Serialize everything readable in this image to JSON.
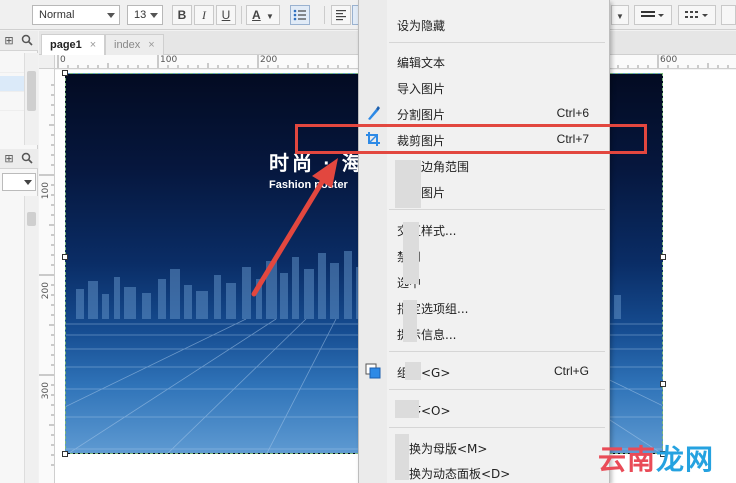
{
  "toolbar": {
    "style_value": "Normal",
    "font_size_value": "13",
    "bold_label": "B",
    "italic_label": "I",
    "underline_label": "U",
    "font_color_label": "A"
  },
  "tabs": [
    {
      "label": "page1",
      "close": "×"
    },
    {
      "label": "index",
      "close": "×"
    }
  ],
  "ruler": {
    "h_labels": [
      "0",
      "100",
      "200",
      "600"
    ],
    "v_labels": [
      "100",
      "200",
      "300"
    ]
  },
  "poster": {
    "title": "时尚 · 海",
    "subtitle": "Fashion poster"
  },
  "menu": {
    "items": [
      {
        "label": "设为隐藏",
        "shortcut": ""
      },
      {
        "label": "编辑文本",
        "shortcut": ""
      },
      {
        "label": "导入图片",
        "shortcut": ""
      },
      {
        "label": "分割图片",
        "shortcut": "Ctrl+6",
        "icon": "split-image-icon"
      },
      {
        "label": "裁剪图片",
        "shortcut": "Ctrl+7",
        "icon": "crop-icon"
      },
      {
        "label": "固定边角范围",
        "shortcut": ""
      },
      {
        "label": "优化图片",
        "shortcut": ""
      },
      {
        "label": "交互样式...",
        "shortcut": ""
      },
      {
        "label": "禁用",
        "shortcut": ""
      },
      {
        "label": "选中",
        "shortcut": ""
      },
      {
        "label": "指定选项组...",
        "shortcut": ""
      },
      {
        "label": "提示信息...",
        "shortcut": ""
      },
      {
        "label": "组合<G>",
        "shortcut": "Ctrl+G",
        "icon": "group-icon"
      },
      {
        "label": "顺序<O>",
        "shortcut": ""
      },
      {
        "label": "转换为母版<M>",
        "shortcut": ""
      },
      {
        "label": "转换为动态面板<D>",
        "shortcut": ""
      }
    ]
  },
  "watermark": {
    "part1": "云南",
    "part2": "龙网"
  },
  "colors": {
    "highlight": "#e2473f",
    "arrow": "#e2473f",
    "accent": "#2e8ae6"
  }
}
